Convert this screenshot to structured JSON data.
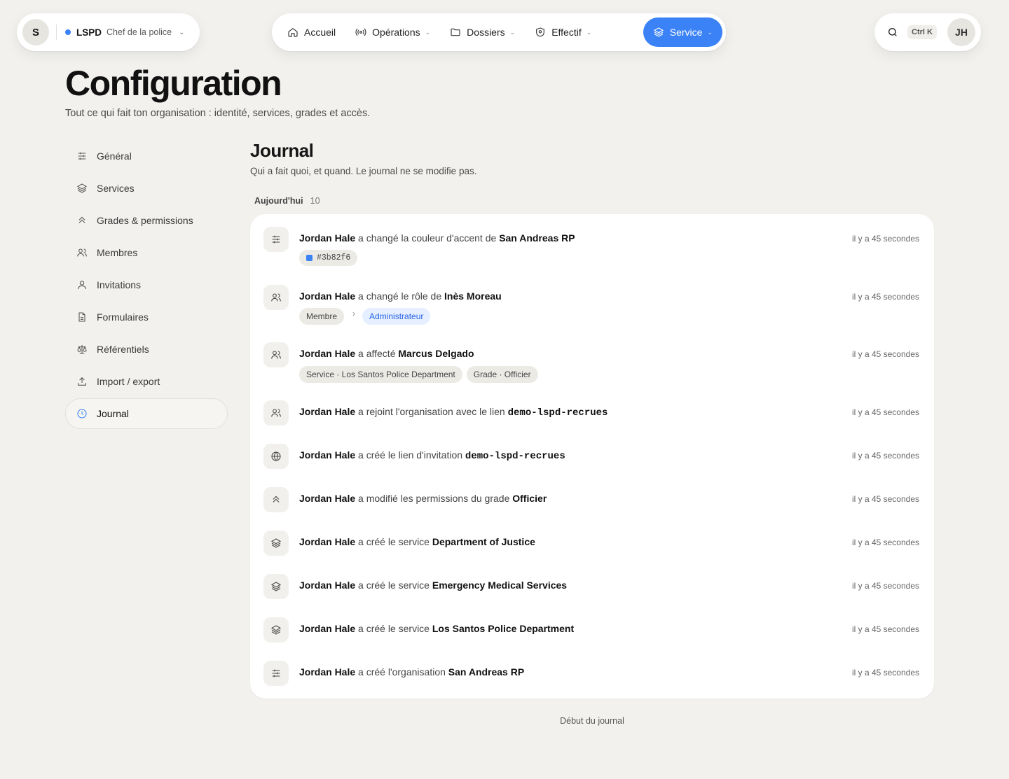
{
  "org": {
    "initial": "S",
    "code": "LSPD",
    "role": "Chef de la police",
    "accent": "#3b82f6"
  },
  "nav": {
    "items": [
      {
        "label": "Accueil",
        "icon": "home-icon"
      },
      {
        "label": "Opérations",
        "icon": "radio-icon"
      },
      {
        "label": "Dossiers",
        "icon": "folder-icon"
      },
      {
        "label": "Effectif",
        "icon": "shield-icon"
      },
      {
        "label": "Service",
        "icon": "layers-icon"
      }
    ]
  },
  "topbar": {
    "shortcut": "Ctrl K",
    "user_initials": "JH"
  },
  "page": {
    "title": "Configuration",
    "subtitle": "Tout ce qui fait ton organisation : identité, services, grades et accès."
  },
  "sidebar": {
    "items": [
      {
        "label": "Général",
        "icon": "sliders-icon"
      },
      {
        "label": "Services",
        "icon": "layers-icon"
      },
      {
        "label": "Grades & permissions",
        "icon": "chevrons-up-icon"
      },
      {
        "label": "Membres",
        "icon": "users-icon"
      },
      {
        "label": "Invitations",
        "icon": "user-icon"
      },
      {
        "label": "Formulaires",
        "icon": "file-icon"
      },
      {
        "label": "Référentiels",
        "icon": "scale-icon"
      },
      {
        "label": "Import / export",
        "icon": "upload-icon"
      },
      {
        "label": "Journal",
        "icon": "clock-icon",
        "active": true
      }
    ]
  },
  "journal": {
    "title": "Journal",
    "subtitle": "Qui a fait quoi, et quand. Le journal ne se modifie pas.",
    "group_label": "Aujourd'hui",
    "group_count": "10",
    "footer": "Début du journal",
    "entries": [
      {
        "icon": "sliders-icon",
        "actor": "Jordan Hale",
        "action": " a changé la couleur d'accent de ",
        "target": "San Andreas RP",
        "time": "il y a 45 secondes",
        "color_tag": "#3b82f6"
      },
      {
        "icon": "users-icon",
        "actor": "Jordan Hale",
        "action": " a changé le rôle de ",
        "target": "Inès Moreau",
        "time": "il y a 45 secondes",
        "from": "Membre",
        "to": "Administrateur"
      },
      {
        "icon": "users-icon",
        "actor": "Jordan Hale",
        "action": " a affecté ",
        "target": "Marcus Delgado",
        "time": "il y a 45 secondes",
        "tag1": "Service · Los Santos Police Department",
        "tag2": "Grade · Officier"
      },
      {
        "icon": "users-icon",
        "actor": "Jordan Hale",
        "action": " a rejoint l'organisation avec le lien ",
        "target": "demo-lspd-recrues",
        "time": "il y a 45 secondes"
      },
      {
        "icon": "globe-icon",
        "actor": "Jordan Hale",
        "action": " a créé le lien d'invitation ",
        "target": "demo-lspd-recrues",
        "time": "il y a 45 secondes"
      },
      {
        "icon": "chevrons-up-icon",
        "actor": "Jordan Hale",
        "action": " a modifié les permissions du grade ",
        "target": "Officier",
        "time": "il y a 45 secondes"
      },
      {
        "icon": "layers-icon",
        "actor": "Jordan Hale",
        "action": " a créé le service ",
        "target": "Department of Justice",
        "time": "il y a 45 secondes"
      },
      {
        "icon": "layers-icon",
        "actor": "Jordan Hale",
        "action": " a créé le service ",
        "target": "Emergency Medical Services",
        "time": "il y a 45 secondes"
      },
      {
        "icon": "layers-icon",
        "actor": "Jordan Hale",
        "action": " a créé le service ",
        "target": "Los Santos Police Department",
        "time": "il y a 45 secondes"
      },
      {
        "icon": "sliders-icon",
        "actor": "Jordan Hale",
        "action": " a créé l'organisation ",
        "target": "San Andreas RP",
        "time": "il y a 45 secondes"
      }
    ]
  }
}
